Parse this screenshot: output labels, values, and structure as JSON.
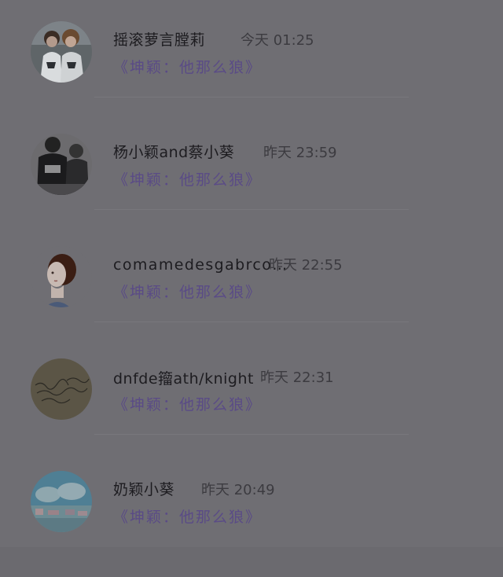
{
  "messages": [
    {
      "name": "摇滚萝言膛莉",
      "time": "今天 01:25",
      "preview": "《坤颖：他那么狼》",
      "avatar_icon": "couple-photo-avatar"
    },
    {
      "name": "杨小颖and蔡小葵",
      "time": "昨天 23:59",
      "preview": "《坤颖：他那么狼》",
      "avatar_icon": "back-view-photo-avatar"
    },
    {
      "name": "comamedesgabrco…",
      "time": "昨天 22:55",
      "preview": "《坤颖：他那么狼》",
      "avatar_icon": "girl-portrait-avatar"
    },
    {
      "name": "dnfde籀ath/knight",
      "time": "昨天 22:31",
      "preview": "《坤颖：他那么狼》",
      "avatar_icon": "handwriting-avatar"
    },
    {
      "name": "奶颖小葵",
      "time": "昨天 20:49",
      "preview": "《坤颖：他那么狼》",
      "avatar_icon": "sky-landscape-avatar"
    }
  ],
  "colors": {
    "background": "#6f6e73",
    "name_text": "#1d1c20",
    "time_text": "#3c3b40",
    "preview_text": "#5a4b86"
  }
}
